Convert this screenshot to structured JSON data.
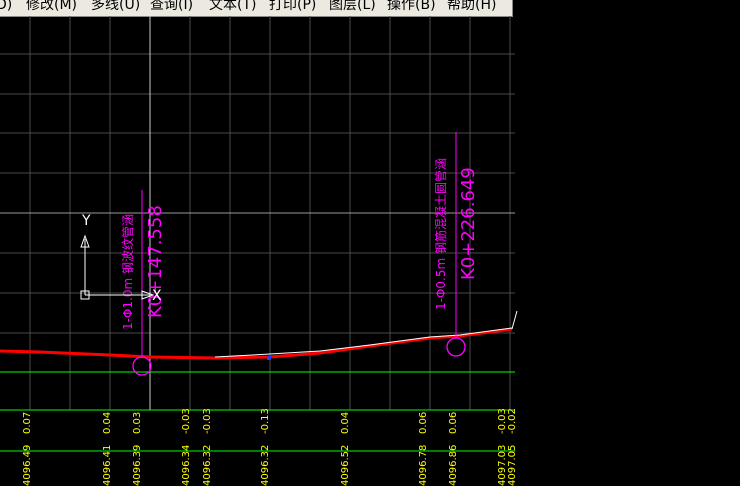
{
  "menubar": {
    "items": [
      "D)",
      "修改(M)",
      "多线(U)",
      "查询(I)",
      "文本(T)",
      "打印(P)",
      "图层(L)",
      "操作(B)",
      "帮助(H)"
    ]
  },
  "drawing": {
    "culverts": [
      {
        "type_label": "1-Φ1.0m 钢波纹管涵",
        "station": "K0+147.558"
      },
      {
        "type_label": "1-Φ0.5m 钢筋混凝土圆管涵",
        "station": "K0+226.649"
      }
    ],
    "ucs": {
      "x_label": "X",
      "y_label": "Y"
    },
    "band_upper_values": [
      "0.07",
      "0.04",
      "0.03",
      "-0.03",
      "-0.03",
      "-0.13",
      "0.04",
      "0.06",
      "0.06",
      "-0.03",
      "-0.02"
    ],
    "band_lower_values": [
      "4096.49",
      "4096.41",
      "4096.39",
      "4096.34",
      "4096.32",
      "4096.32",
      "4096.52",
      "4096.78",
      "4096.86",
      "4097.03",
      "4097.05"
    ],
    "colors": {
      "background": "#000000",
      "grid": "#4a4a4a",
      "profile_line": "#ff0000",
      "culvert_text": "#ff00ff",
      "band_text": "#ffff00",
      "band_line": "#00ff00",
      "crosshair": "#c8c8c8"
    }
  }
}
